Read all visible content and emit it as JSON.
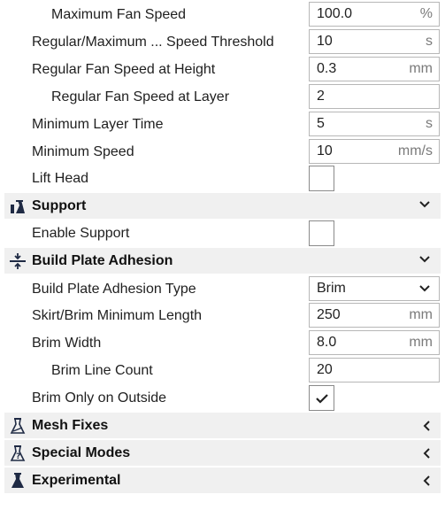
{
  "settings_top": [
    {
      "label": "Maximum Fan Speed",
      "value": "100.0",
      "unit": "%"
    },
    {
      "label": "Regular/Maximum ... Speed Threshold",
      "value": "10",
      "unit": "s"
    },
    {
      "label": "Regular Fan Speed at Height",
      "value": "0.3",
      "unit": "mm"
    },
    {
      "label": "Regular Fan Speed at Layer",
      "value": "2",
      "unit": ""
    },
    {
      "label": "Minimum Layer Time",
      "value": "5",
      "unit": "s"
    },
    {
      "label": "Minimum Speed",
      "value": "10",
      "unit": "mm/s"
    },
    {
      "label": "Lift Head",
      "checked": false
    }
  ],
  "categories": {
    "support": {
      "label": "Support",
      "icon": "support-icon",
      "expanded": true
    },
    "adhesion": {
      "label": "Build Plate Adhesion",
      "icon": "adhesion-icon",
      "expanded": true
    },
    "mesh_fixes": {
      "label": "Mesh Fixes",
      "icon": "mesh-fixes-icon",
      "expanded": false
    },
    "special_modes": {
      "label": "Special Modes",
      "icon": "special-modes-icon",
      "expanded": false
    },
    "experimental": {
      "label": "Experimental",
      "icon": "experimental-icon",
      "expanded": false
    }
  },
  "support_settings": [
    {
      "label": "Enable Support",
      "checked": false
    }
  ],
  "adhesion_settings": [
    {
      "label": "Build Plate Adhesion Type",
      "value": "Brim"
    },
    {
      "label": "Skirt/Brim Minimum Length",
      "value": "250",
      "unit": "mm"
    },
    {
      "label": "Brim Width",
      "value": "8.0",
      "unit": "mm"
    },
    {
      "label": "Brim Line Count",
      "value": "20",
      "unit": ""
    },
    {
      "label": "Brim Only on Outside",
      "checked": true
    }
  ],
  "colors": {
    "category_bg": "#f0f0f0",
    "text": "#1f1f1f",
    "unit": "#7a7a7a",
    "border": "#b7b7b7"
  }
}
